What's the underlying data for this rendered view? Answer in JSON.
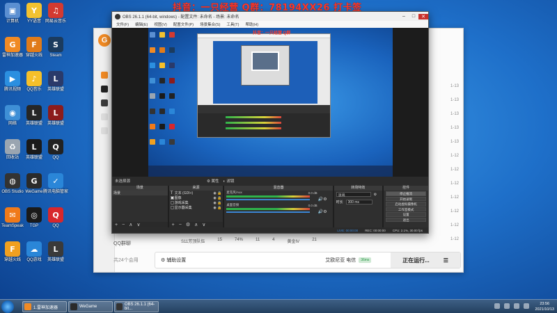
{
  "stream_banner": "抖音：一只经营  Q群：78194XX26  打卡签",
  "desktop": {
    "icons": [
      {
        "label": "计算机",
        "color": "#5b8fd1",
        "glyph": "▣"
      },
      {
        "label": "YY语音",
        "color": "#f2c230",
        "glyph": "Y"
      },
      {
        "label": "网易云音乐",
        "color": "#d33a31",
        "glyph": "♫"
      },
      {
        "label": "雷神加速器",
        "color": "#f08a24",
        "glyph": "G"
      },
      {
        "label": "穿越火线",
        "color": "#e07b1a",
        "glyph": "F"
      },
      {
        "label": "Steam",
        "color": "#1b3b5e",
        "glyph": "S"
      },
      {
        "label": "腾讯视频",
        "color": "#2b8fe0",
        "glyph": "▶"
      },
      {
        "label": "QQ音乐",
        "color": "#f5c02a",
        "glyph": "♪"
      },
      {
        "label": "英雄联盟",
        "color": "#2a3a6a",
        "glyph": "L"
      },
      {
        "label": "网络",
        "color": "#3e8fd6",
        "glyph": "◉"
      },
      {
        "label": "英雄联盟",
        "color": "#262626",
        "glyph": "L"
      },
      {
        "label": "英雄联盟",
        "color": "#8c1c1c",
        "glyph": "L"
      },
      {
        "label": "回收站",
        "color": "#9aa5b1",
        "glyph": "♻"
      },
      {
        "label": "英雄联盟",
        "color": "#1a1a1a",
        "glyph": "L"
      },
      {
        "label": "QQ",
        "color": "#222",
        "glyph": "Q"
      },
      {
        "label": "OBS Studio",
        "color": "#333",
        "glyph": "◍"
      },
      {
        "label": "WeGame",
        "color": "#2a2a2a",
        "glyph": "G"
      },
      {
        "label": "腾讯电脑管家",
        "color": "#2a86d8",
        "glyph": "✓"
      },
      {
        "label": "TeamSpeak",
        "color": "#f07a1a",
        "glyph": "✉"
      },
      {
        "label": "TGP",
        "color": "#1a1a1a",
        "glyph": "◎"
      },
      {
        "label": "QQ",
        "color": "#d8272c",
        "glyph": "Q"
      },
      {
        "label": "穿越火线",
        "color": "#f0a020",
        "glyph": "F"
      },
      {
        "label": "QQ游戏",
        "color": "#2a86d8",
        "glyph": "☁"
      },
      {
        "label": "英雄联盟",
        "color": "#3a3a3a",
        "glyph": "L"
      }
    ]
  },
  "bg_app": {
    "logo_glyph": "G",
    "qq_label": "QQ群聊",
    "hours_label": "共24个会用",
    "right_dates": [
      "1-13",
      "1-13",
      "1-13",
      "1-13",
      "1-13",
      "1-12",
      "1-12",
      "1-12",
      "1-12",
      "1-12",
      "1-12",
      "1-12"
    ],
    "row": [
      "S11芳顶队伍",
      "15",
      "74%",
      "11",
      "4",
      "黄金IV",
      "21"
    ],
    "assist_label": "辅助设置",
    "status_text": "艾欧尼亚 电信",
    "status_badge": "36ms",
    "running_label": "正在运行..."
  },
  "obs": {
    "title": "OBS 26.1.1 (64-bit, windows) - 配置文件: 未命名 - 场景: 未命名",
    "menu": [
      "文件(F)",
      "编辑(E)",
      "视图(V)",
      "配置文件(P)",
      "场景集合(S)",
      "工具(T)",
      "帮助(H)"
    ],
    "no_source": "未选择源",
    "tool_props": "属性",
    "tool_filters": "滤镜",
    "watermark": "抖音：一只经营  Q群",
    "docks": {
      "scenes_title": "场景",
      "scene_item": "场景",
      "sources_title": "来源",
      "sources": [
        {
          "type": "T",
          "name": "文本 (GDI+)"
        },
        {
          "type": "▣",
          "name": "图像"
        },
        {
          "type": "▢",
          "name": "游戏采集"
        },
        {
          "type": "▢",
          "name": "显示器采集"
        }
      ],
      "mixer_title": "混音器",
      "mixer_channels": [
        {
          "name": "麦克风/Aux",
          "db": "0.0 dB"
        },
        {
          "name": "桌面音频",
          "db": "0.0 dB"
        }
      ],
      "trans_title": "转场特效",
      "trans_value": "淡出",
      "trans_duration_label": "时长",
      "trans_duration": "300 ms",
      "controls_title": "控件",
      "controls": [
        "停止推流",
        "开始录制",
        "启动虚拟摄像机",
        "工作室模式",
        "设置",
        "退出"
      ]
    },
    "status": {
      "live": "LIVE: 00:00:00",
      "rec": "REC: 00:00:00",
      "cpu": "CPU: 2.1%, 30.00 fps"
    }
  },
  "taskbar": {
    "tasks": [
      {
        "label": "1.雷神加速器",
        "color": "#f08a24"
      },
      {
        "label": "WeGame",
        "color": "#2a2a2a"
      },
      {
        "label": "OBS 26.1.1 (64-bit...",
        "color": "#333"
      }
    ],
    "clock_time": "23:56",
    "clock_date": "2021/10/13"
  }
}
